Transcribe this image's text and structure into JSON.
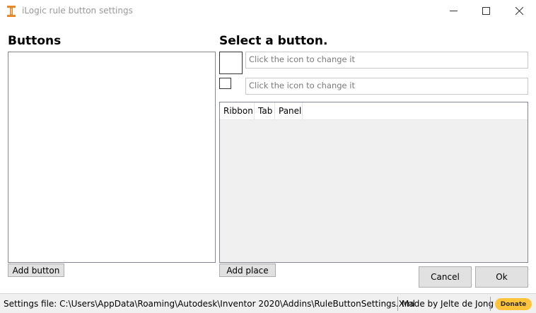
{
  "window": {
    "title": "iLogic rule button settings",
    "minimize_icon": "minimize-icon",
    "maximize_icon": "maximize-icon",
    "close_icon": "close-icon"
  },
  "buttons_panel": {
    "heading": "Buttons",
    "items": [],
    "add_button_label": "Add button"
  },
  "details_panel": {
    "heading": "Select a button.",
    "large_icon_placeholder": "Click the icon to change it",
    "small_icon_placeholder": "Click the icon to change it",
    "places_table": {
      "columns": [
        "Ribbon",
        "Tab",
        "Panel"
      ],
      "rows": []
    },
    "add_place_label": "Add place"
  },
  "actions": {
    "cancel_label": "Cancel",
    "ok_label": "Ok"
  },
  "status": {
    "settings_file": "Settings file: C:\\Users\\AppData\\Roaming\\Autodesk\\Inventor 2020\\Addins\\RuleButtonSettings.Xml",
    "credit": "Made by Jelte de Jong",
    "donate_label": "Donate"
  },
  "colors": {
    "accent_icon": "#e8892c",
    "donate_bg": "#ffc439",
    "button_bg": "#e1e1e1",
    "statusbar_bg": "#f0f0f0"
  }
}
